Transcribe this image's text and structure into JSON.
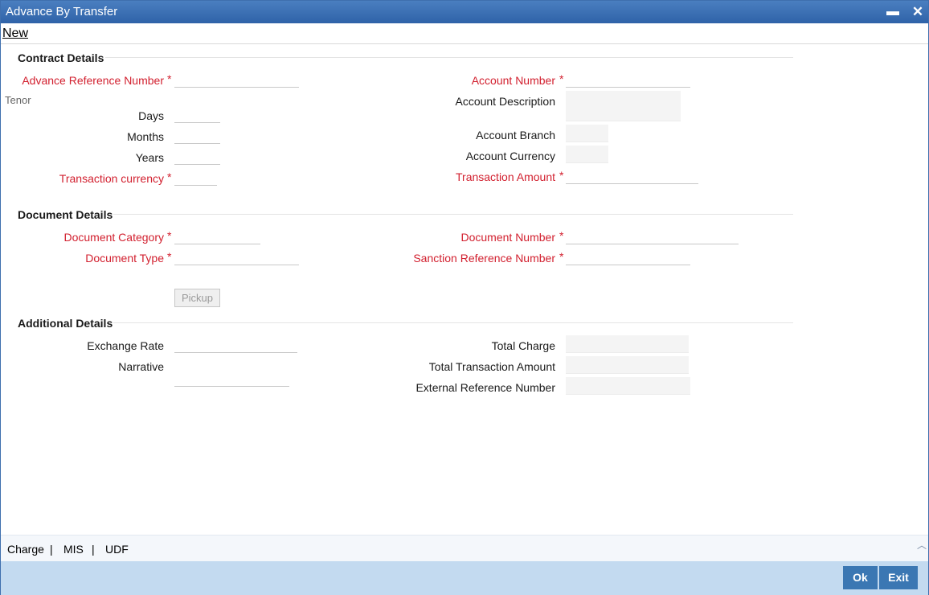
{
  "window": {
    "title": "Advance By Transfer"
  },
  "toolbar": {
    "new_label": "New"
  },
  "contract": {
    "title": "Contract Details",
    "advance_ref_label": "Advance Reference Number",
    "tenor_label": "Tenor",
    "days_label": "Days",
    "months_label": "Months",
    "years_label": "Years",
    "txn_currency_label": "Transaction currency",
    "account_number_label": "Account Number",
    "account_description_label": "Account Description",
    "account_branch_label": "Account Branch",
    "account_currency_label": "Account Currency",
    "txn_amount_label": "Transaction Amount"
  },
  "document": {
    "title": "Document Details",
    "category_label": "Document Category",
    "type_label": "Document Type",
    "number_label": "Document Number",
    "sanction_label": "Sanction Reference Number",
    "pickup_label": "Pickup"
  },
  "additional": {
    "title": "Additional Details",
    "exchange_rate_label": "Exchange Rate",
    "narrative_label": "Narrative",
    "total_charge_label": "Total Charge",
    "total_txn_amount_label": "Total Transaction Amount",
    "external_ref_label": "External Reference Number"
  },
  "required_marker": "*",
  "bottom_tabs": {
    "charge": "Charge",
    "mis": "MIS",
    "udf": "UDF",
    "separator": "|"
  },
  "footer": {
    "ok_label": "Ok",
    "exit_label": "Exit"
  },
  "colors": {
    "titlebar": "#2f62a8",
    "required": "#d2202f",
    "footer": "#c3daf0",
    "button": "#3b77b3"
  }
}
